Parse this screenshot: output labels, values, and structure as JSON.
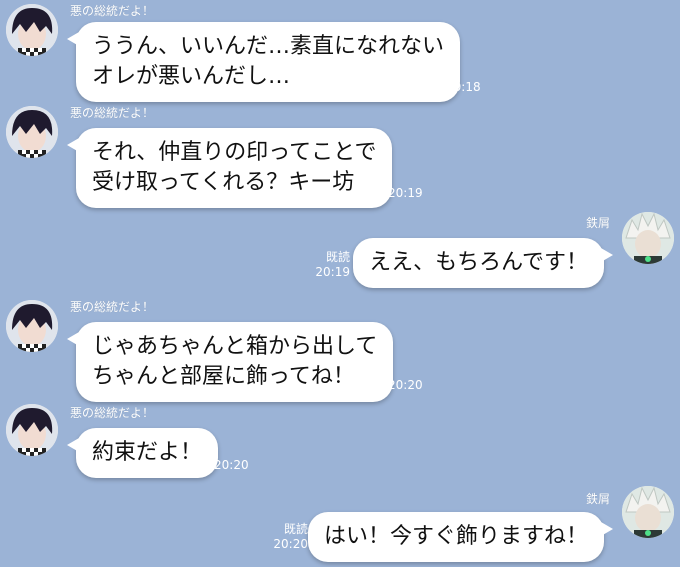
{
  "messages": [
    {
      "sender": "悪の総統だよ！",
      "avatar_icon": "ouma-avatar-icon",
      "text": "ううん、いいんだ…素直になれない\nオレが悪いんだし…",
      "time": "20:18"
    },
    {
      "sender": "悪の総統だよ！",
      "avatar_icon": "ouma-avatar-icon",
      "text": "それ、仲直りの印ってことで\n受け取ってくれる？キー坊",
      "time": "20:19"
    },
    {
      "sender": "鉄屑",
      "avatar_icon": "kiibo-avatar-icon",
      "text": "ええ、もちろんです！",
      "read": "既読",
      "time": "20:19"
    },
    {
      "sender": "悪の総統だよ！",
      "avatar_icon": "ouma-avatar-icon",
      "text": "じゃあちゃんと箱から出して\nちゃんと部屋に飾ってね！",
      "time": "20:20"
    },
    {
      "sender": "悪の総統だよ！",
      "avatar_icon": "ouma-avatar-icon",
      "text": "約束だよ！",
      "time": "20:20"
    },
    {
      "sender": "鉄屑",
      "avatar_icon": "kiibo-avatar-icon",
      "text": "はい！今すぐ飾りますね！",
      "read": "既読",
      "time": "20:20"
    }
  ],
  "colors": {
    "background": "#9bb3d6",
    "bubble": "#ffffff",
    "meta_text": "#ffffff"
  }
}
